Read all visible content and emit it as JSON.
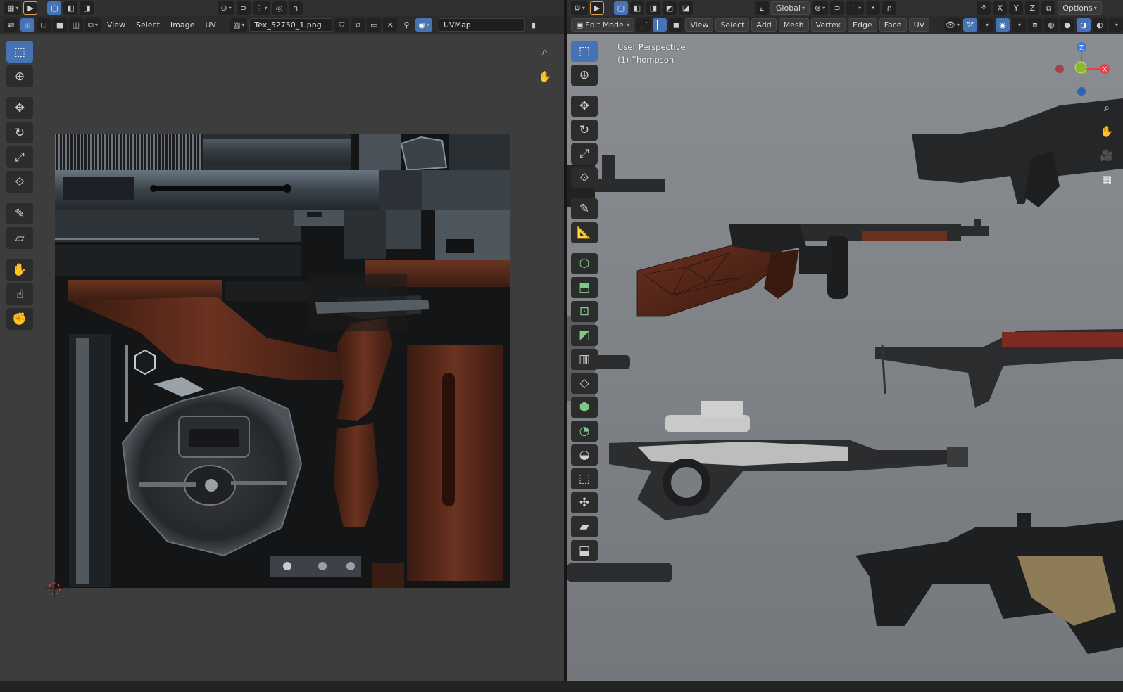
{
  "left": {
    "header": {
      "menus": [
        "View",
        "Select",
        "Image",
        "UV"
      ],
      "image_name": "Tex_52750_1.png",
      "uv_map": "UVMap"
    },
    "tools": [
      "select-box",
      "cursor",
      "move",
      "rotate",
      "scale",
      "transform",
      "annotate",
      "rip-region",
      "grab",
      "relax",
      "pinch"
    ]
  },
  "right": {
    "header": {
      "orientation": "Global",
      "axes": [
        "X",
        "Y",
        "Z"
      ],
      "options": "Options",
      "mode": "Edit Mode",
      "menus": [
        "View",
        "Select",
        "Add",
        "Mesh",
        "Vertex",
        "Edge",
        "Face",
        "UV"
      ]
    },
    "overlay": {
      "perspective": "User Perspective",
      "object": "(1) Thompson"
    },
    "gizmo": {
      "x": "X",
      "z": "Z"
    }
  },
  "colors": {
    "accent": "#4772b3",
    "wood": "#5b2b1c",
    "metal": "#5e6670",
    "x_axis": "#e0444e",
    "y_axis": "#8ab82e",
    "z_axis": "#3a7cd8"
  }
}
